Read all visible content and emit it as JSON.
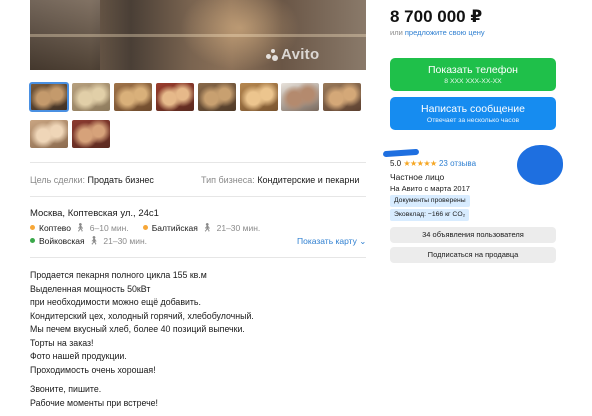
{
  "gallery": {
    "watermark": "Avito",
    "thumbnails": [
      {
        "name": "counter",
        "colors": [
          "#7a5a3a",
          "#c49a6c",
          "#3d2f24"
        ]
      },
      {
        "name": "buns",
        "colors": [
          "#b7a07e",
          "#e1cfa8",
          "#8d7a5c"
        ]
      },
      {
        "name": "bread",
        "colors": [
          "#a0744a",
          "#d9b07a",
          "#6e4a2c"
        ]
      },
      {
        "name": "tart",
        "colors": [
          "#9b3d2d",
          "#e6b98a",
          "#5a2a1f"
        ]
      },
      {
        "name": "rolls",
        "colors": [
          "#8a6a4a",
          "#c8a070",
          "#4f3a28"
        ]
      },
      {
        "name": "pastry",
        "colors": [
          "#b78850",
          "#ecc58e",
          "#7a5530"
        ]
      },
      {
        "name": "cake",
        "colors": [
          "#e9e3dc",
          "#b48a6e",
          "#7a6a5e"
        ]
      },
      {
        "name": "loaf",
        "colors": [
          "#9a7a5a",
          "#d4a878",
          "#5c4030"
        ]
      },
      {
        "name": "cookies",
        "colors": [
          "#c9a582",
          "#efd6b8",
          "#8a6a4e"
        ]
      },
      {
        "name": "berry-tart",
        "colors": [
          "#8c3b30",
          "#d6a27a",
          "#5a2a20"
        ]
      }
    ]
  },
  "deal": {
    "goal_label": "Цель сделки:",
    "goal_value": "Продать бизнес",
    "type_label": "Тип бизнеса:",
    "type_value": "Кондитерские и пекарни"
  },
  "location": {
    "address": "Москва, Коптевская ул., 24с1",
    "metro": [
      {
        "name": "Коптево",
        "time": "6–10 мин.",
        "color": "#f7a738"
      },
      {
        "name": "Балтийская",
        "time": "21–30 мин.",
        "color": "#f7a738"
      },
      {
        "name": "Войковская",
        "time": "21–30 мин.",
        "color": "#3aa84a"
      }
    ],
    "map_link": "Показать карту",
    "map_link_icon": "chevron-down-icon"
  },
  "description": [
    "Продается пекарня полного цикла 155 кв.м",
    "Выделенная мощность 50кВт",
    "при необходимости можно ещё добавить.",
    "Кондитерский цех, холодный горячий, хлебобулочный.",
    "Мы печем вкусный хлеб, более 40 позиций выпечки.",
    "Торты на заказ!",
    "Фото нашей продукции.",
    "Проходимость очень хорошая!",
    "",
    "Звоните, пишите.",
    "Рабочие моменты при встрече!"
  ],
  "sidebar": {
    "price": "8 700 000 ₽",
    "price_or": "или",
    "price_offer": "предложите свою цену",
    "call_button": "Показать телефон",
    "call_sub": "8 XXX XXX-XX-XX",
    "message_button": "Написать сообщение",
    "message_sub": "Отвечает за несколько часов",
    "rating": "5.0",
    "stars": "★★★★★",
    "reviews": "23 отзыва",
    "seller_type": "Частное лицо",
    "seller_since": "На Авито с марта 2017",
    "badges": [
      "Документы проверены",
      "Эковклад: −166 кг CO₂"
    ],
    "listings_button": "34 объявления пользователя",
    "subscribe_button": "Подписаться на продавца",
    "accent_green": "#1fc04a",
    "accent_blue": "#168cf0"
  }
}
